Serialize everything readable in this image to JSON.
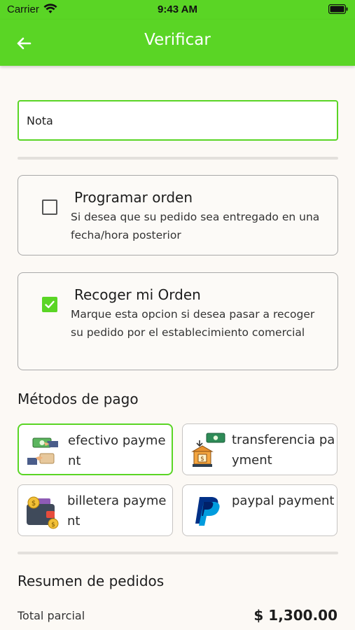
{
  "status_bar": {
    "carrier": "Carrier",
    "time": "9:43 AM"
  },
  "app_bar": {
    "title": "Verificar"
  },
  "note": {
    "placeholder": "Nota"
  },
  "options": [
    {
      "title": "Programar orden",
      "description": "Si desea que su pedido sea entregado en una fecha/hora posterior",
      "checked": false
    },
    {
      "title": "Recoger mi Orden",
      "description": "Marque esta opcion si desea pasar a recoger su pedido por el establecimiento comercial",
      "checked": true
    }
  ],
  "payment": {
    "title": "Métodos de pago",
    "methods": [
      {
        "label": "efectivo payment",
        "icon": "cash-hands-icon",
        "selected": true
      },
      {
        "label": "transferencia payment",
        "icon": "bank-transfer-icon",
        "selected": false
      },
      {
        "label": "billetera payment",
        "icon": "wallet-icon",
        "selected": false
      },
      {
        "label": "paypal payment",
        "icon": "paypal-icon",
        "selected": false
      }
    ]
  },
  "summary": {
    "title": "Resumen de pedidos",
    "subtotal_label": "Total parcial",
    "subtotal_value": "$ 1,300.00"
  },
  "colors": {
    "accent": "#5ad525",
    "background": "#fcf9f5"
  }
}
